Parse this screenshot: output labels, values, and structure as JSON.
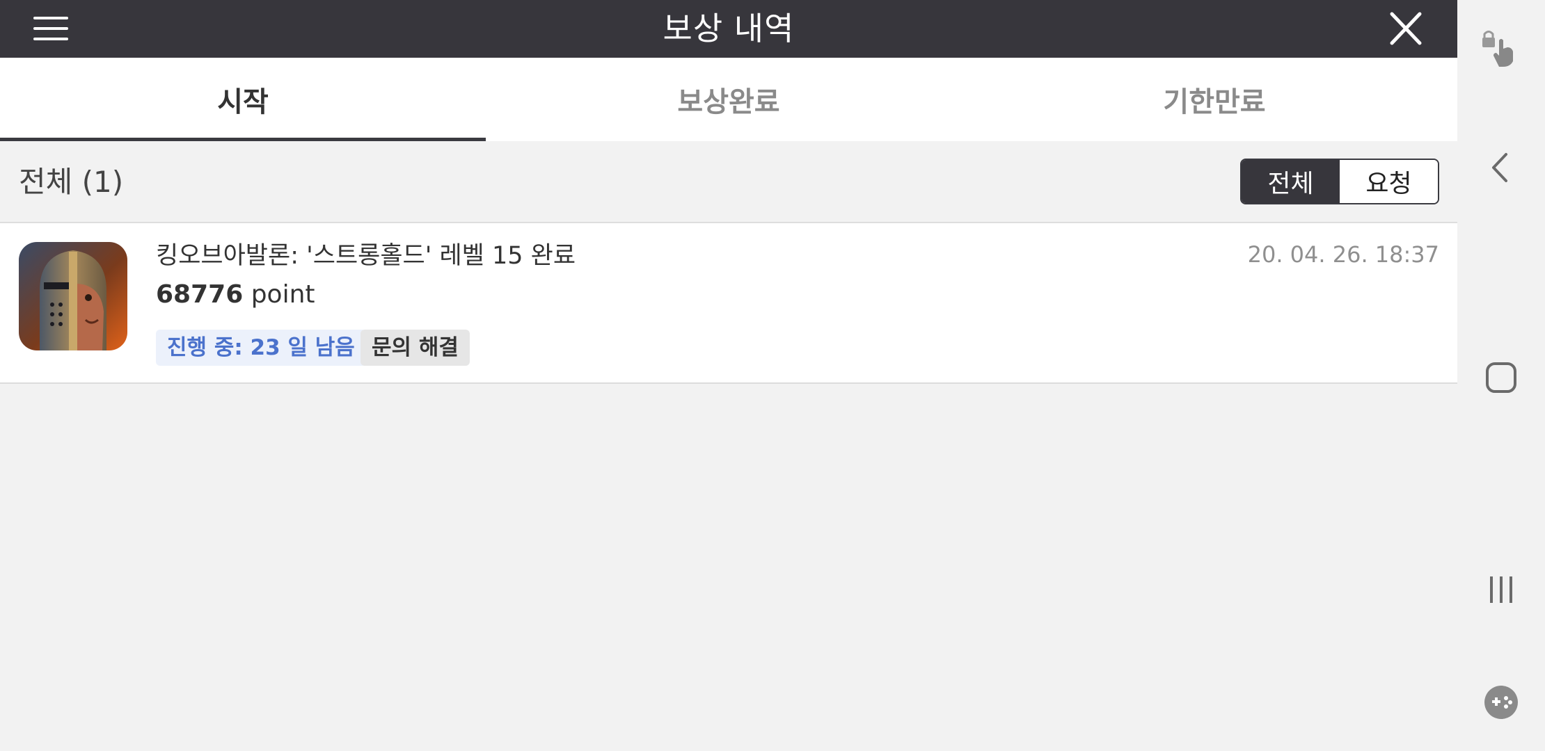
{
  "header": {
    "title": "보상 내역"
  },
  "tabs": [
    {
      "label": "시작",
      "active": true
    },
    {
      "label": "보상완료",
      "active": false
    },
    {
      "label": "기한만료",
      "active": false
    }
  ],
  "filter": {
    "count_label": "전체 (1)",
    "segments": [
      {
        "label": "전체",
        "active": true
      },
      {
        "label": "요청",
        "active": false
      }
    ]
  },
  "items": [
    {
      "title": "킹오브아발론: '스트롱홀드' 레벨 15 완료",
      "points_value": "68776",
      "points_unit": "point",
      "date": "20. 04. 26. 18:37",
      "status_badge": "진행 중: 23 일 남음",
      "action_badge": "문의 해결"
    }
  ],
  "colors": {
    "header_bg": "#37363c",
    "accent_blue": "#4b72cc",
    "badge_blue_bg": "#ecf1fb"
  },
  "system_nav": {
    "icons": [
      "lock-touch-icon",
      "back-icon",
      "home-icon",
      "recents-icon",
      "game-tools-icon"
    ]
  }
}
